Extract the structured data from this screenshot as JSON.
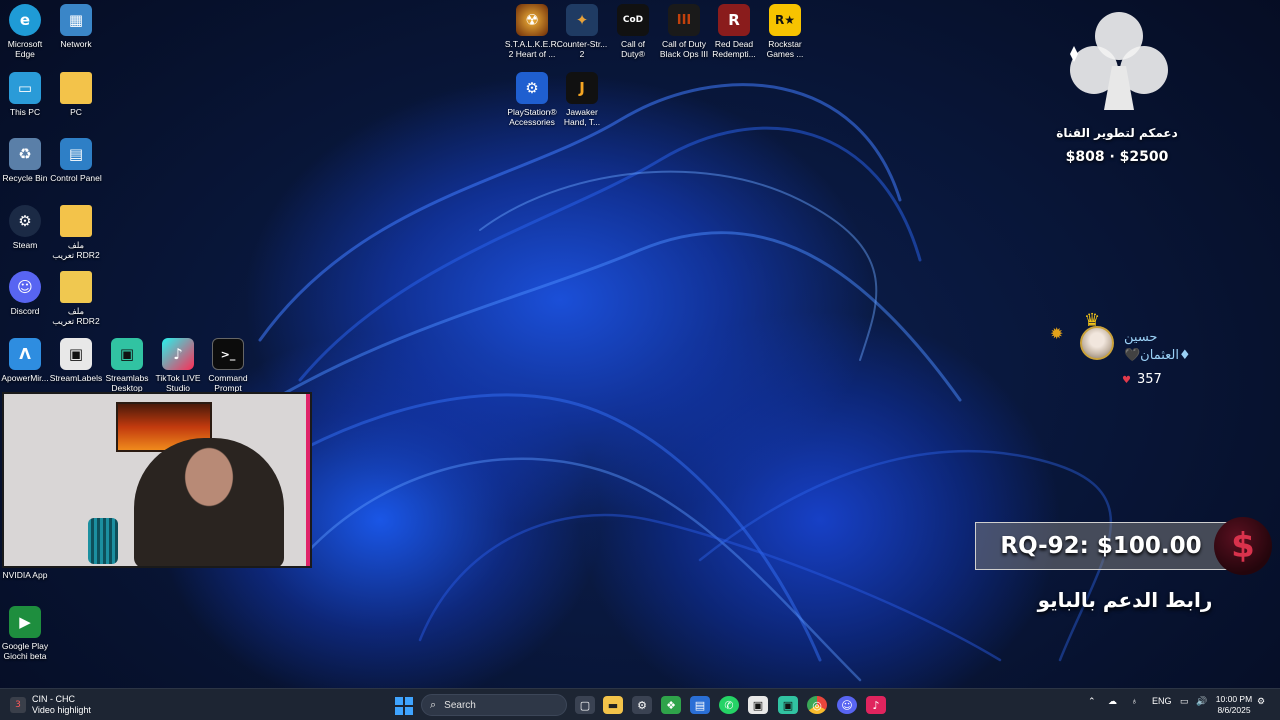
{
  "desktop_icons": [
    {
      "id": "edge",
      "label": "Microsoft\nEdge",
      "icon": "edge-icon",
      "color": "#1f9bd6",
      "glyph": "e"
    },
    {
      "id": "network",
      "label": "Network",
      "icon": "network-icon",
      "color": "#3a86c8",
      "glyph": "🖧"
    },
    {
      "id": "this-pc",
      "label": "This PC",
      "icon": "monitor-icon",
      "color": "#2a9bd8",
      "glyph": "▭"
    },
    {
      "id": "pc",
      "label": "PC",
      "icon": "folder-icon",
      "color": "#f3c34a",
      "glyph": ""
    },
    {
      "id": "recycle-bin",
      "label": "Recycle Bin",
      "icon": "recycle-bin-icon",
      "color": "#5a7fa8",
      "glyph": "♻"
    },
    {
      "id": "control-panel",
      "label": "Control Panel",
      "icon": "control-panel-icon",
      "color": "#2e7fc6",
      "glyph": "▤"
    },
    {
      "id": "steam",
      "label": "Steam",
      "icon": "steam-icon",
      "color": "#1b2a45",
      "glyph": "⚙"
    },
    {
      "id": "rdr2-folder-1",
      "label": "ملف\nتعريب RDR2",
      "icon": "folder-icon",
      "color": "#f3c34a",
      "glyph": ""
    },
    {
      "id": "discord",
      "label": "Discord",
      "icon": "discord-icon",
      "color": "#5865f2",
      "glyph": "☺"
    },
    {
      "id": "rdr2-folder-2",
      "label": "ملف\nتعريب RDR2",
      "icon": "folder-zip-icon",
      "color": "#f0c850",
      "glyph": ""
    },
    {
      "id": "apowermirror",
      "label": "ApowerMir...",
      "icon": "apowermirror-icon",
      "color": "#2e8de0",
      "glyph": "Λ"
    },
    {
      "id": "streamlabels",
      "label": "StreamLabels",
      "icon": "streamlabels-icon",
      "color": "#e8e8e8",
      "glyph": "▣"
    },
    {
      "id": "streamlabs",
      "label": "Streamlabs\nDesktop",
      "icon": "streamlabs-icon",
      "color": "#31c3a2",
      "glyph": "▣"
    },
    {
      "id": "tiktok-live",
      "label": "TikTok LIVE\nStudio",
      "icon": "tiktok-live-studio-icon",
      "color": "#111111",
      "glyph": "♪"
    },
    {
      "id": "cmd",
      "label": "Command\nPrompt",
      "icon": "command-prompt-icon",
      "color": "#0c0c0c",
      "glyph": ">_"
    },
    {
      "id": "stalker",
      "label": "S.T.A.L.K.E.R.\n2 Heart of ...",
      "icon": "stalker-icon",
      "color": "#d07a1a",
      "glyph": "☢"
    },
    {
      "id": "cs2",
      "label": "Counter-Str...\n2",
      "icon": "counter-strike-icon",
      "color": "#e7a23a",
      "glyph": "✦"
    },
    {
      "id": "cod",
      "label": "Call of\nDuty®",
      "icon": "call-of-duty-icon",
      "color": "#111111",
      "glyph": "CoD"
    },
    {
      "id": "bo3",
      "label": "Call of Duty\nBlack Ops III",
      "icon": "black-ops-icon",
      "color": "#c2410c",
      "glyph": "III"
    },
    {
      "id": "rdr",
      "label": "Red Dead\nRedempti...",
      "icon": "red-dead-icon",
      "color": "#8a1c1c",
      "glyph": "R"
    },
    {
      "id": "rockstar",
      "label": "Rockstar\nGames ...",
      "icon": "rockstar-icon",
      "color": "#f7c300",
      "glyph": "R★"
    },
    {
      "id": "ps-accessories",
      "label": "PlayStation®\nAccessories",
      "icon": "playstation-icon",
      "color": "#1f5fd0",
      "glyph": "⚙"
    },
    {
      "id": "jawaker",
      "label": "Jawaker\nHand, T...",
      "icon": "jawaker-icon",
      "color": "#111111",
      "glyph": "J"
    },
    {
      "id": "nvidia",
      "label": "NVIDIA App",
      "icon": "nvidia-icon",
      "color": "#76b900",
      "glyph": "◉"
    },
    {
      "id": "google-play",
      "label": "Google Play\nGiochi beta",
      "icon": "google-play-games-icon",
      "color": "#1e8e3e",
      "glyph": "▶"
    }
  ],
  "stream_overlay": {
    "goal_title": "دعمكم لتطوير القناة",
    "goal_amount": "$808 · $2500",
    "gifter_name_line1": "حسين",
    "gifter_name_line2": "♦العثمان🖤",
    "gifter_likes": "357",
    "donation_text": "RQ-92: $100.00",
    "dollar_symbol": "$",
    "support_link_text": "رابط الدعم بالبايو"
  },
  "taskbar": {
    "notification_app": "CIN - CHC",
    "notification_sub": "Video highlight",
    "notification_count": "3",
    "search_placeholder": "Search",
    "apps": [
      {
        "id": "task-view",
        "icon": "task-view-icon",
        "glyph": "▢",
        "color": "#3a4252"
      },
      {
        "id": "explorer",
        "icon": "file-explorer-icon",
        "glyph": "📁",
        "color": "#f3c34a"
      },
      {
        "id": "settings-tb",
        "icon": "gear-icon",
        "glyph": "⚙",
        "color": "#3a4252"
      },
      {
        "id": "app-green",
        "icon": "widgets-icon",
        "glyph": "❖",
        "color": "#2fa34a"
      },
      {
        "id": "store",
        "icon": "store-icon",
        "glyph": "▤",
        "color": "#2a6fd6"
      },
      {
        "id": "whatsapp",
        "icon": "whatsapp-icon",
        "glyph": "✆",
        "color": "#25d366"
      },
      {
        "id": "streamlabels-tb",
        "icon": "streamlabels-icon",
        "glyph": "▣",
        "color": "#e8e8e8"
      },
      {
        "id": "streamlabs-tb",
        "icon": "streamlabs-icon",
        "glyph": "▣",
        "color": "#31c3a2"
      },
      {
        "id": "chrome",
        "icon": "chrome-icon",
        "glyph": "◎",
        "color": "#e8453c"
      },
      {
        "id": "discord-tb",
        "icon": "discord-icon",
        "glyph": "☺",
        "color": "#5865f2"
      },
      {
        "id": "tiktok-tb",
        "icon": "tiktok-icon",
        "glyph": "♪",
        "color": "#e0245e"
      }
    ],
    "tray_language": "ENG",
    "clock_time": "10:00 PM",
    "clock_date": "8/6/2025"
  },
  "colors": {
    "accent": "#1b4fd8",
    "taskbar_bg": "#1d2533"
  }
}
